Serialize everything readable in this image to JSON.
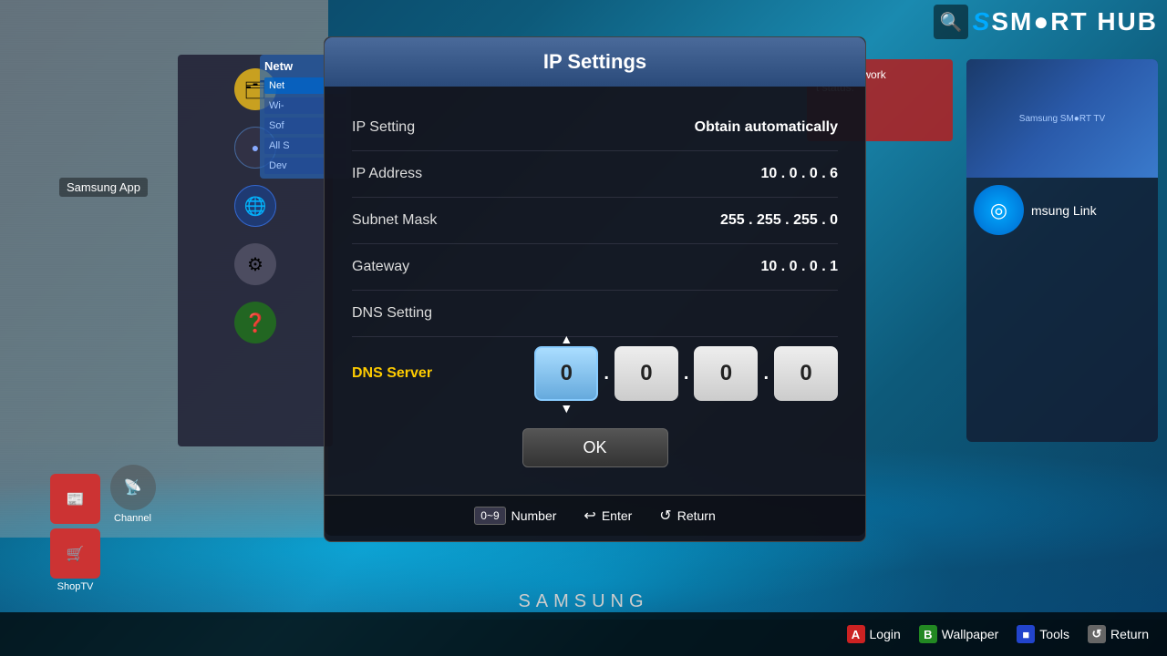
{
  "tv": {
    "brand": "SAMSUNG",
    "smart_hub_label": "SM●RT HUB"
  },
  "modal": {
    "title": "IP Settings",
    "rows": [
      {
        "label": "IP Setting",
        "value": "Obtain automatically"
      },
      {
        "label": "IP Address",
        "value": "10 . 0 . 0 . 6"
      },
      {
        "label": "Subnet Mask",
        "value": "255 . 255 . 255 . 0"
      },
      {
        "label": "Gateway",
        "value": "10 . 0 . 0 . 1"
      }
    ],
    "dns_setting_label": "DNS Setting",
    "dns_server_label": "DNS Server",
    "dns_values": [
      "0",
      "0",
      "0",
      "0"
    ],
    "ok_button": "OK",
    "footer": [
      {
        "key": "0~9",
        "label": "Number"
      },
      {
        "icon": "enter-icon",
        "label": "Enter"
      },
      {
        "icon": "return-icon",
        "label": "Return"
      }
    ]
  },
  "sidebar": {
    "network_label": "Netw",
    "items": [
      {
        "label": "Net",
        "active": true
      },
      {
        "label": "Wi-",
        "active": false
      },
      {
        "label": "Sof",
        "active": false
      },
      {
        "label": "All S",
        "active": false
      },
      {
        "label": "Dev",
        "active": false
      }
    ]
  },
  "taskbar": {
    "items": [
      {
        "badge": "A",
        "badge_color": "red",
        "label": "Login"
      },
      {
        "badge": "B",
        "badge_color": "green",
        "label": "Wallpaper"
      },
      {
        "badge": "■",
        "badge_color": "blue",
        "label": "Tools"
      },
      {
        "badge": "↺",
        "badge_color": "gray",
        "label": "Return"
      }
    ]
  },
  "apps": {
    "channel_label": "Channel",
    "shoptv_label": "ShopTV",
    "samsung_apps_label": "Samsung App",
    "samsung_link_label": "msung Link",
    "network_status_lines": [
      "urrent network",
      "t status."
    ]
  },
  "smart_hub": {
    "title": "SM●RT HUB",
    "subtitle": "Samsung SM●RT TV"
  }
}
